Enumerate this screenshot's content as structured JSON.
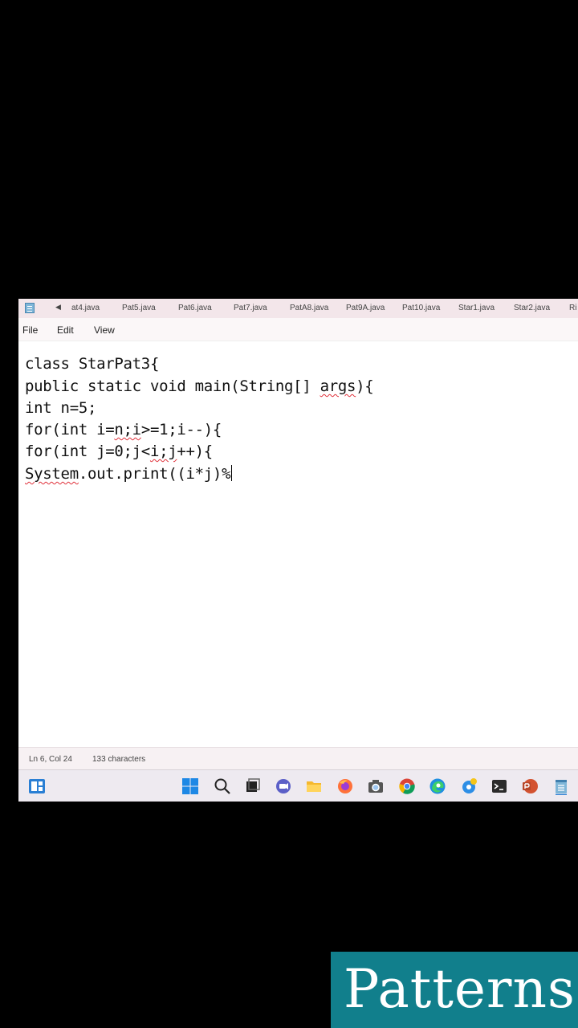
{
  "tabs": [
    {
      "label": "at4.java"
    },
    {
      "label": "Pat5.java"
    },
    {
      "label": "Pat6.java"
    },
    {
      "label": "Pat7.java"
    },
    {
      "label": "PatA8.java"
    },
    {
      "label": "Pat9A.java"
    },
    {
      "label": "Pat10.java"
    },
    {
      "label": "Star1.java"
    },
    {
      "label": "Star2.java"
    },
    {
      "label": "Ri"
    }
  ],
  "menu": {
    "file": "File",
    "edit": "Edit",
    "view": "View"
  },
  "code": {
    "line1": "class StarPat3{",
    "line2a": "public static void main(String[] ",
    "line2b": "args",
    "line2c": "){",
    "line3": "int n=5;",
    "line4a": "for(int i=",
    "line4b": "n;i",
    "line4c": ">=1;i--){",
    "line5a": "for(int j=0;j<",
    "line5b": "i;j",
    "line5c": "++){",
    "line6a": "System",
    "line6b": ".out.print((i*j)%"
  },
  "status": {
    "position": "Ln 6, Col 24",
    "characters": "133 characters"
  },
  "overlay": {
    "text": "Patterns"
  },
  "colors": {
    "accent": "#117f8c",
    "squiggle": "#e0303a",
    "tabbar": "#f3e6ea"
  },
  "taskbar_icons": [
    "widgets-icon",
    "start-icon",
    "search-icon",
    "task-view-icon",
    "teams-icon",
    "file-explorer-icon",
    "firefox-icon",
    "camera-icon",
    "chrome-icon",
    "edge-icon",
    "settings-icon",
    "terminal-icon",
    "powerpoint-icon",
    "notepad-icon"
  ]
}
